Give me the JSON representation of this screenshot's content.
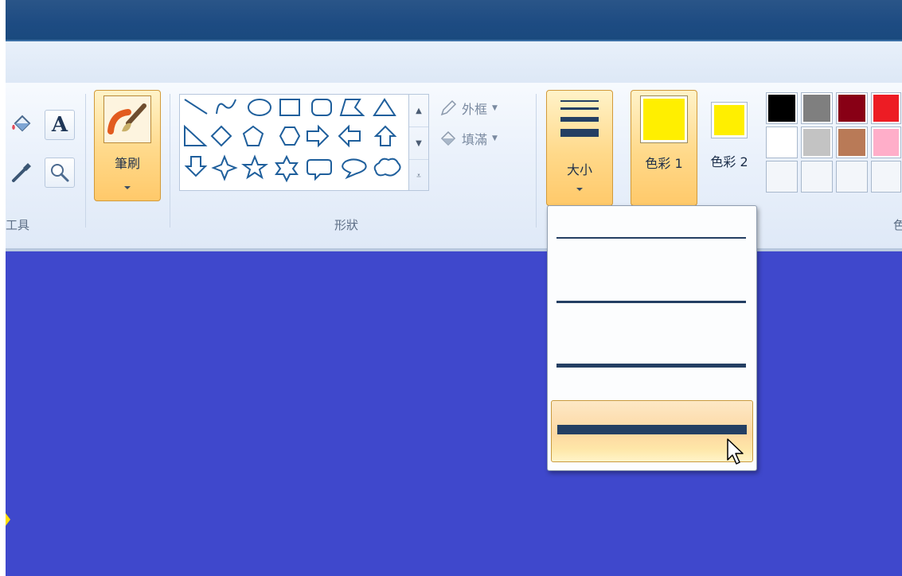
{
  "ribbon": {
    "tools_group_label": "工具",
    "shapes_group_label": "形狀",
    "colors_group_label_partial": "色",
    "brush_label": "筆刷",
    "outline_label": "外框",
    "fill_label": "填滿",
    "size_label": "大小",
    "color1_label": "色彩 1",
    "color2_label": "色彩 2"
  },
  "tools": {
    "icons": [
      "fill-bucket-icon",
      "text-icon",
      "color-picker-icon",
      "magnifier-icon"
    ],
    "text_glyph": "A"
  },
  "shapes": [
    [
      "line",
      "curve",
      "oval",
      "rectangle",
      "rounded-rectangle",
      "polygon",
      "triangle"
    ],
    [
      "right-triangle",
      "diamond",
      "pentagon",
      "hexagon",
      "right-arrow",
      "left-arrow",
      "up-arrow"
    ],
    [
      "down-arrow",
      "four-point-star",
      "five-point-star",
      "six-point-star",
      "rounded-callout",
      "oval-callout",
      "cloud-callout"
    ]
  ],
  "colors": {
    "color1": "#ffef00",
    "color2": "#ffef00",
    "palette_row1": [
      "#000000",
      "#7f7f7f",
      "#880015",
      "#ed1c24"
    ],
    "palette_row2": [
      "#ffffff",
      "#c3c3c3",
      "#b97a57",
      "#ffaec9"
    ],
    "palette_row3": [
      "#f3f6fa",
      "#f3f6fa",
      "#f3f6fa",
      "#f3f6fa"
    ]
  },
  "canvas": {
    "background": "#3f48cc"
  },
  "size_menu": {
    "options": [
      {
        "name": "1px",
        "thickness": 1
      },
      {
        "name": "3px",
        "thickness": 3
      },
      {
        "name": "5px",
        "thickness": 5
      },
      {
        "name": "8px",
        "thickness": 8
      }
    ],
    "selected_index": 3
  }
}
